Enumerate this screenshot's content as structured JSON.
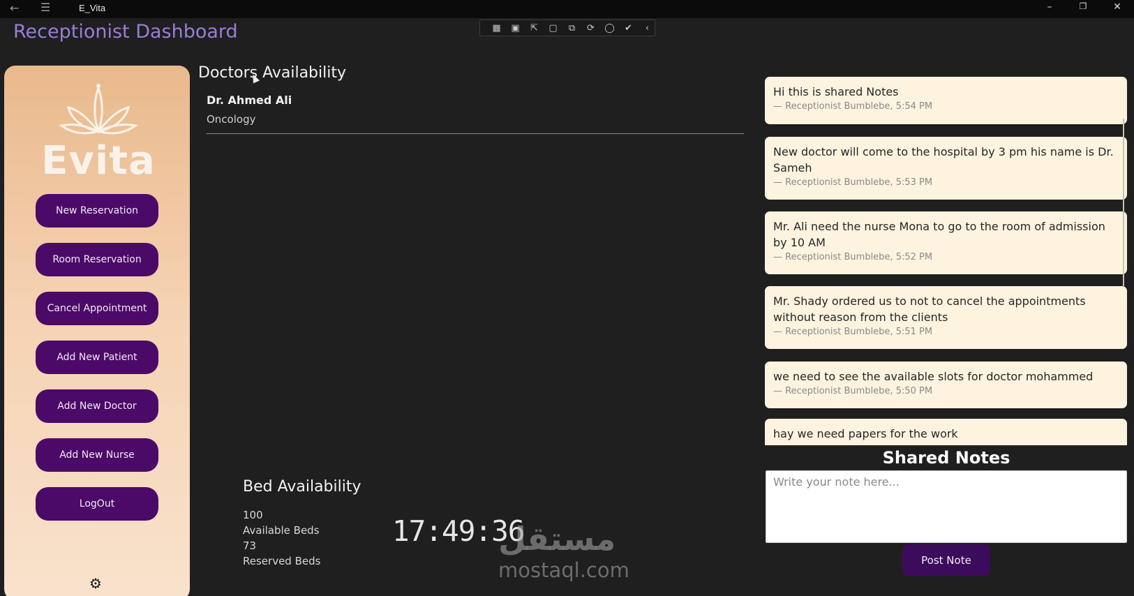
{
  "window": {
    "title": "E_Vita",
    "back_icon": "back-arrow-icon",
    "menu_icon": "hamburger-menu-icon",
    "minimize": "–",
    "maximize": "❐",
    "close": "✕"
  },
  "page_title": "Receptionist Dashboard",
  "sidebar": {
    "logo_text": "Evita",
    "buttons": [
      {
        "label": "New Reservation"
      },
      {
        "label": "Room Reservation"
      },
      {
        "label": "Cancel Appointment"
      },
      {
        "label": "Add New Patient"
      },
      {
        "label": "Add New Doctor"
      },
      {
        "label": "Add New Nurse"
      },
      {
        "label": "LogOut"
      }
    ],
    "settings_icon": "⚙"
  },
  "doctors": {
    "title": "Doctors Availability",
    "list": [
      {
        "name": "Dr. Ahmed Ali",
        "specialty": "Oncology"
      }
    ]
  },
  "beds": {
    "title": "Bed Availability",
    "available_count": "100",
    "available_label": "Available Beds",
    "reserved_count": "73",
    "reserved_label": "Reserved Beds"
  },
  "clock": "17:49:36",
  "notes": {
    "title": "Shared Notes",
    "items": [
      {
        "text": "Hi this is shared Notes",
        "meta": "— Receptionist Bumblebe, 5:54 PM"
      },
      {
        "text": "New doctor will come to the hospital by 3 pm his name is Dr. Sameh",
        "meta": "— Receptionist Bumblebe, 5:53 PM"
      },
      {
        "text": "Mr. Ali need the nurse Mona to go to the room of admission by 10 AM",
        "meta": "— Receptionist Bumblebe, 5:52 PM"
      },
      {
        "text": "Mr. Shady ordered us to not to cancel the appointments without reason from the clients",
        "meta": "— Receptionist Bumblebe, 5:51 PM"
      },
      {
        "text": "we need to see the available slots for doctor mohammed",
        "meta": "— Receptionist Bumblebe, 5:50 PM"
      },
      {
        "text": "hay we need papers for the work",
        "meta": ""
      }
    ],
    "input_placeholder": "Write your note here...",
    "post_label": "Post Note"
  },
  "watermark": {
    "arabic": "مستقل",
    "latin": "mostaql.com"
  },
  "colors": {
    "accent": "#9b7ed8",
    "button": "#4b0a67",
    "note_bg": "#fdf3df"
  }
}
